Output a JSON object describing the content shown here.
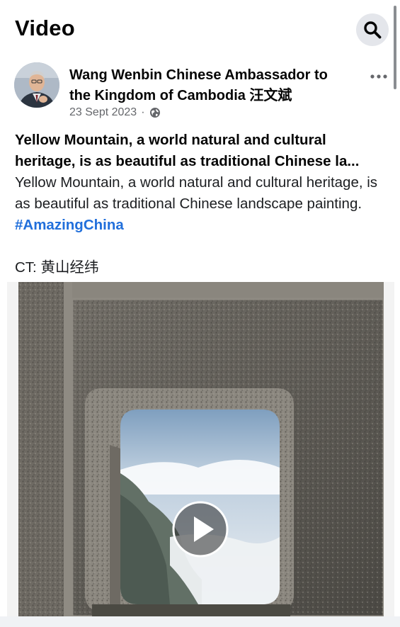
{
  "header": {
    "title": "Video",
    "search_icon": "search-icon"
  },
  "post": {
    "author": "Wang Wenbin Chinese Ambassador to the Kingdom of Cambodia 汪文斌",
    "date": "23 Sept 2023",
    "separator": "·",
    "audience_icon": "globe-icon",
    "more_icon": "more-options-icon",
    "title": "Yellow Mountain, a world natural and cultural heritage, is as beautiful as traditional Chinese la...",
    "body_text": "Yellow Mountain, a world natural and cultural heritage, is as beautiful as traditional Chinese landscape painting.",
    "hashtag": "#AmazingChina",
    "credit": "CT: 黄山经纬"
  },
  "video": {
    "play_icon": "play-icon"
  },
  "colors": {
    "link": "#216fdb",
    "secondary_text": "#65676b",
    "button_bg": "#e4e6eb"
  }
}
